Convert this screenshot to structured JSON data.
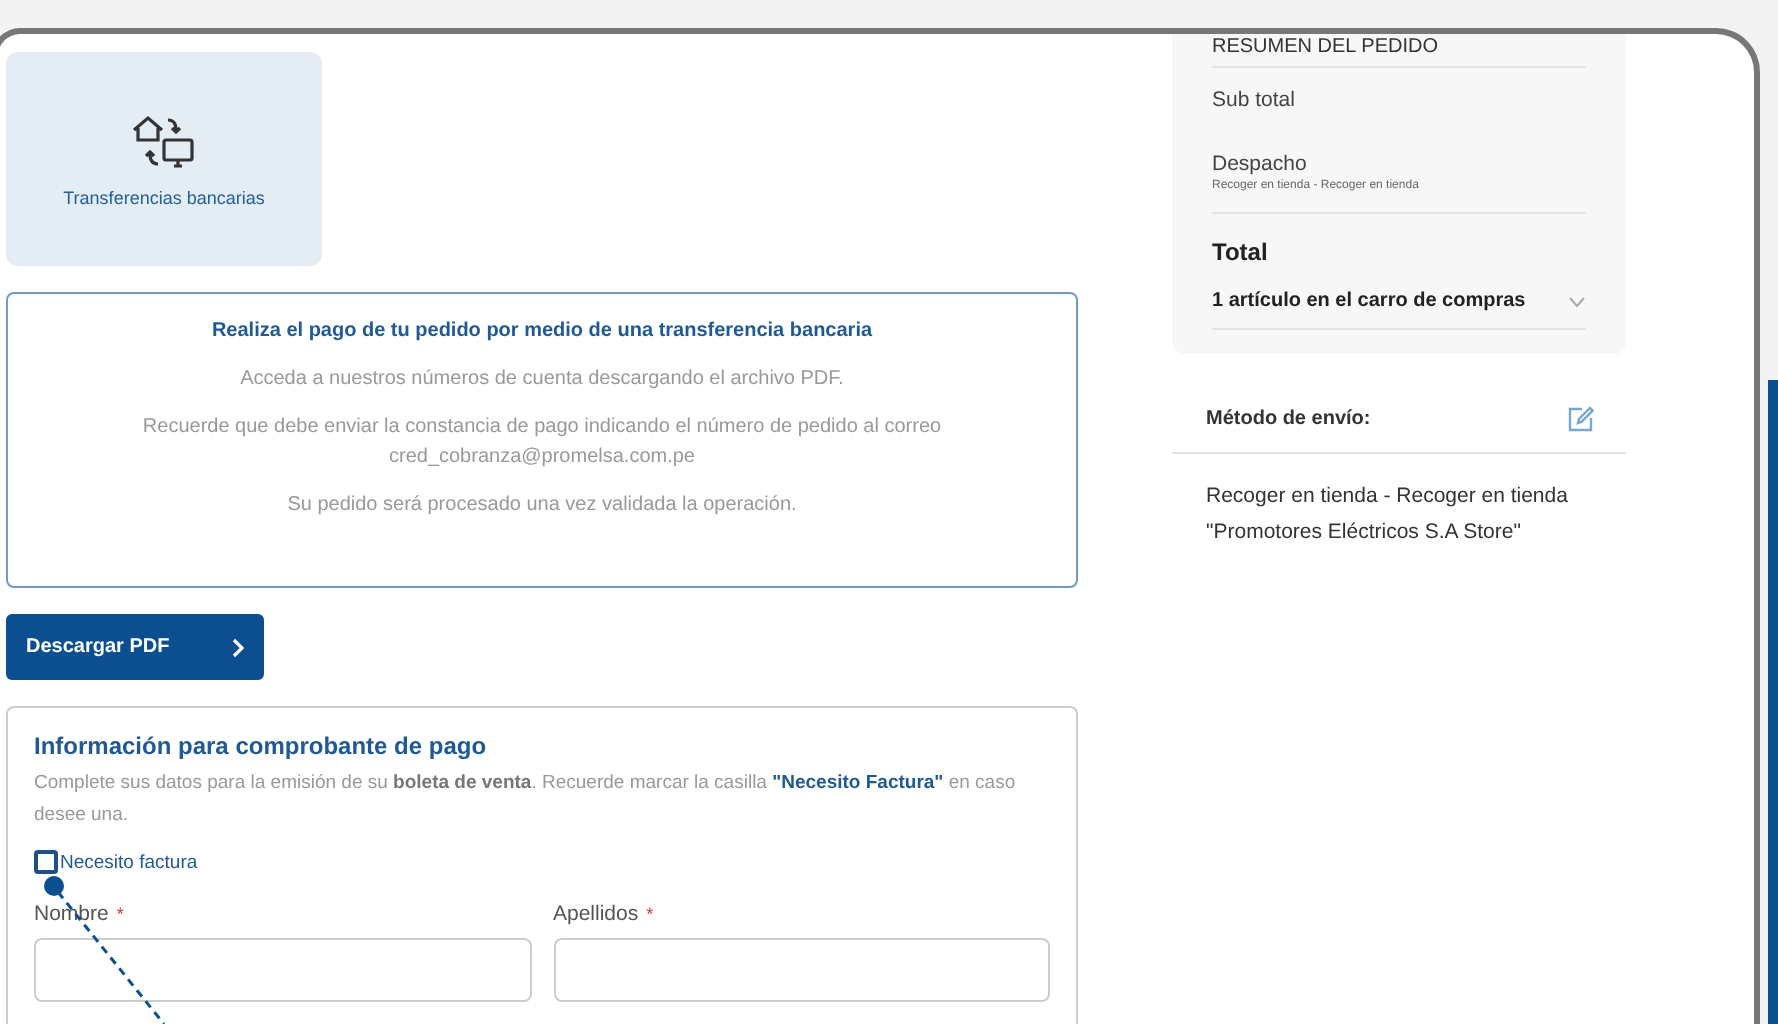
{
  "payment_option": {
    "label": "Transferencias bancarias"
  },
  "transfer_info": {
    "title": "Realiza el pago de tu pedido por medio de una transferencia bancaria",
    "paragraphs": [
      [
        "Acceda a nuestros números de cuenta descargando el archivo PDF."
      ],
      [
        "Recuerde que debe enviar la constancia de pago indicando el número de pedido al correo",
        "cred_cobranza@promelsa.com.pe"
      ],
      [
        "Su pedido será procesado una vez validada la operación."
      ]
    ]
  },
  "download_button": {
    "label": "Descargar PDF"
  },
  "billing": {
    "title": "Información para comprobante de pago",
    "description": "Complete sus datos para la emisión de su **boleta de venta**. Recuerde marcar la casilla **\"Necesito Factura\"** en caso desee una.",
    "invoice_checkbox": {
      "label": "Necesito factura",
      "checked": false
    },
    "fields": [
      {
        "label": "Nombre",
        "mark": "*"
      },
      {
        "label": "Apellidos",
        "mark": "*"
      }
    ]
  },
  "summary": {
    "title": "RESUMEN DEL PEDIDO",
    "subtotal_label": "Sub total",
    "shipping_label": "Despacho",
    "shipping_detail": "Recoger en tienda - Recoger en tienda",
    "total_label": "Total",
    "cart_toggle": {
      "label": "1 artículo en el carro de compras",
      "expanded": false
    }
  },
  "shipping_method": {
    "title": "Método de envío:",
    "lines": [
      "Recoger en tienda - Recoger en tienda",
      "\"Promotores Eléctricos S.A Store\""
    ]
  }
}
